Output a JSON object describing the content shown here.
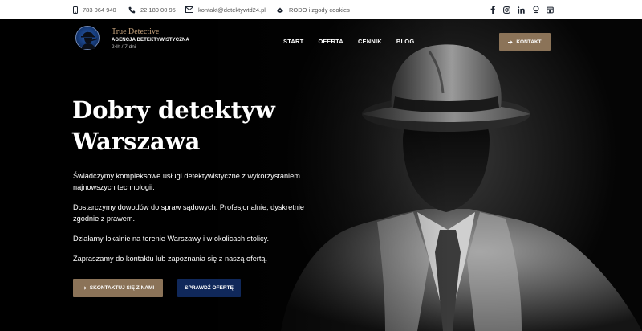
{
  "topbar": {
    "phone1": "783 064 940",
    "phone2": "22 180 00 95",
    "email": "kontakt@detektywtd24.pl",
    "rodo": "RODO i zgody cookies",
    "social": [
      "facebook-icon",
      "instagram-icon",
      "linkedin-icon",
      "pin-icon",
      "store-icon"
    ]
  },
  "brand": {
    "name": "True Detective",
    "subtitle": "AGENCJA DETEKTYWISTYCZNA",
    "hours": "24h / 7 dni"
  },
  "nav": {
    "items": [
      "START",
      "OFERTA",
      "CENNIK",
      "BLOG"
    ],
    "contact_button": "KONTAKT"
  },
  "hero": {
    "title_line1": "Dobry detektyw",
    "title_line2": "Warszawa",
    "paragraphs": [
      "Świadczymy kompleksowe usługi detektywistyczne z wykorzystaniem najnowszych technologii.",
      "Dostarczymy dowodów do spraw sądowych. Profesjonalnie, dyskretnie i zgodnie z prawem.",
      "Działamy lokalnie na terenie Warszawy i w okolicach stolicy.",
      "Zapraszamy do kontaktu lub zapoznania się z naszą ofertą."
    ],
    "primary_button": "SKONTAKTUJ SIĘ Z NAMI",
    "secondary_button": "SPRAWDŹ OFERTĘ"
  },
  "colors": {
    "accent": "#8b7358",
    "brand_gold": "#c3a07a",
    "navy": "#10285a"
  }
}
